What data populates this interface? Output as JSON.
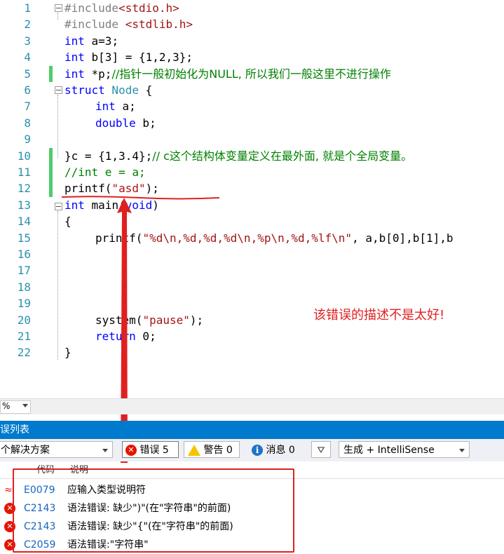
{
  "editor": {
    "line_numbers": [
      "1",
      "2",
      "3",
      "4",
      "5",
      "6",
      "7",
      "8",
      "9",
      "10",
      "11",
      "12",
      "13",
      "14",
      "15",
      "16",
      "17",
      "18",
      "19",
      "20",
      "21",
      "22"
    ],
    "lines": {
      "l1_pp": "#include",
      "l1_hdr": "<stdio.h>",
      "l2_pp": "#include ",
      "l2_hdr": "<stdlib.h>",
      "l3_kw": "int",
      "l3_rest": " a=3;",
      "l4_kw": "int",
      "l4_rest": " b[3] = {1,2,3};",
      "l5_kw": "int",
      "l5_rest": " *p;",
      "l5_cm": "//指针一般初始化为NULL, 所以我们一般这里不进行操作",
      "l6_kw": "struct",
      "l6_type": " Node",
      "l6_rest": " {",
      "l7_kw": "int",
      "l7_rest": " a;",
      "l8_kw": "double",
      "l8_rest": " b;",
      "l10_rest": "}c = {1,3.4};",
      "l10_cm": "// c这个结构体变量定义在最外面, 就是个全局变量。",
      "l11_cm": "//int e = a;",
      "l12_fn": "printf(",
      "l12_str": "\"asd\"",
      "l12_rest": ");",
      "l13_kw": "int",
      "l13_rest": " main(",
      "l13_kw2": "void",
      "l13_rest2": ")",
      "l14": "{",
      "l15_fn": "printf(",
      "l15_str": "\"%d\\n,%d,%d,%d\\n,%p\\n,%d,%lf\\n\"",
      "l15_rest": ", a,b[0],b[1],b",
      "l20_fn": "system(",
      "l20_str": "\"pause\"",
      "l20_rest": ");",
      "l21_kw": "return",
      "l21_rest": " 0;",
      "l22": "}"
    },
    "annotation": "该错误的描述不是太好!"
  },
  "zoom": {
    "value": "%"
  },
  "panel": {
    "title": "误列表",
    "scope": "个解决方案",
    "errors_label": "错误 5",
    "warnings_label": "警告 0",
    "messages_label": "消息 0",
    "build_filter": "生成 + IntelliSense",
    "col_code": "代码",
    "col_desc": "说明"
  },
  "errors": [
    {
      "code": "E0079",
      "desc": "应输入类型说明符",
      "icon": "squiggle-icon"
    },
    {
      "code": "C2143",
      "desc": "语法错误: 缺少\")\"(在\"字符串\"的前面)",
      "icon": "error-icon"
    },
    {
      "code": "C2143",
      "desc": "语法错误: 缺少\"{\"(在\"字符串\"的前面)",
      "icon": "error-icon"
    },
    {
      "code": "C2059",
      "desc": "语法错误:\"字符串\"",
      "icon": "error-icon"
    }
  ],
  "colors": {
    "keyword": "#0000ff",
    "string": "#a31515",
    "type": "#2b91af",
    "comment": "#008000",
    "line_number": "#2b91af",
    "accent": "#007acc",
    "annotation_red": "#e02020"
  }
}
